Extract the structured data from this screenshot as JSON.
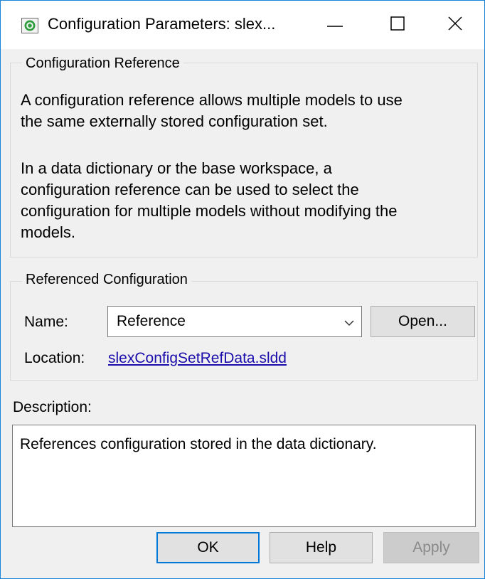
{
  "window": {
    "title": "Configuration Parameters: slex...",
    "icons": {
      "app": "simulink-gear-icon",
      "minimize": "minimize-icon",
      "maximize": "maximize-icon",
      "close": "close-icon"
    }
  },
  "configuration_reference": {
    "group_title": "Configuration Reference",
    "paragraph1_lines": [
      "A configuration reference allows multiple models to use",
      "the same externally stored configuration set."
    ],
    "paragraph2_lines": [
      "In a data dictionary or the base workspace, a",
      "configuration reference can be used to select the",
      "configuration for multiple models without modifying the",
      "models."
    ]
  },
  "referenced_configuration": {
    "group_title": "Referenced Configuration",
    "name_label": "Name:",
    "name_value": "Reference",
    "open_button": "Open...",
    "location_label": "Location:",
    "location_link": "slexConfigSetRefData.sldd"
  },
  "description": {
    "label": "Description:",
    "text": "References configuration stored in the data dictionary."
  },
  "buttons": {
    "ok": "OK",
    "help": "Help",
    "apply": "Apply"
  },
  "colors": {
    "window_border": "#1883d7",
    "link": "#1a0dab",
    "default_button_border": "#0078d7"
  }
}
